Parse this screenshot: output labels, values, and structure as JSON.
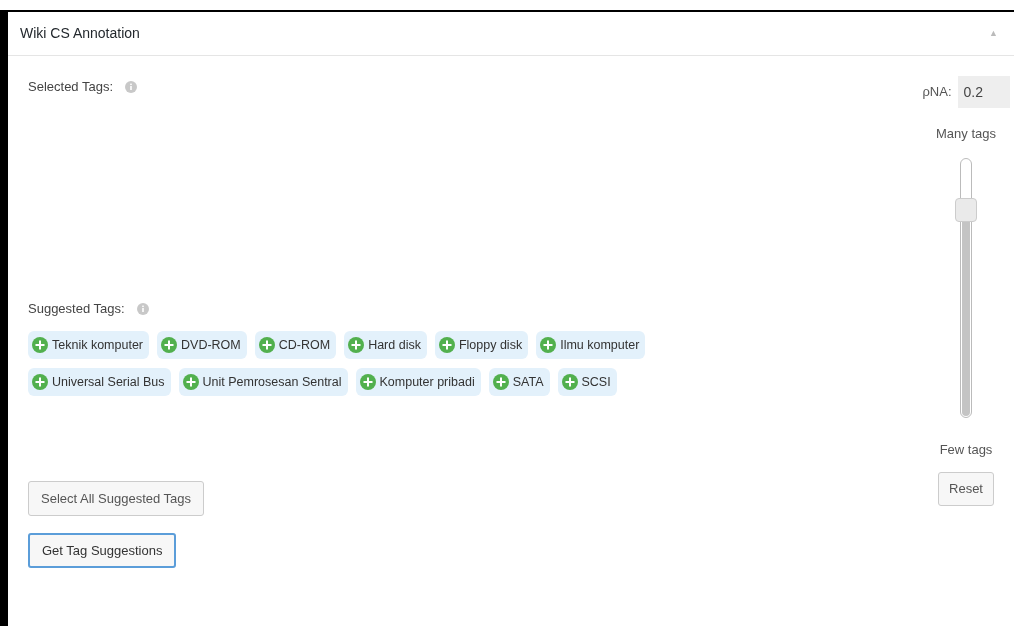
{
  "panel": {
    "title": "Wiki CS Annotation",
    "collapse_icon": "▲"
  },
  "selected_tags": {
    "label": "Selected Tags:"
  },
  "suggested_tags": {
    "label": "Suggested Tags:",
    "tags": [
      {
        "label": "Teknik komputer"
      },
      {
        "label": "DVD-ROM"
      },
      {
        "label": "CD-ROM"
      },
      {
        "label": "Hard disk"
      },
      {
        "label": "Floppy disk"
      },
      {
        "label": "Ilmu komputer"
      },
      {
        "label": "Universal Serial Bus"
      },
      {
        "label": "Unit Pemrosesan Sentral"
      },
      {
        "label": "Komputer pribadi"
      },
      {
        "label": "SATA"
      },
      {
        "label": "SCSI"
      }
    ]
  },
  "buttons": [
    {
      "label": "Select All Suggested Tags",
      "focused": false
    },
    {
      "label": "Get Tag Suggestions",
      "focused": true
    }
  ],
  "pna": {
    "label": "ρNA:",
    "value": "0.2",
    "top_label": "Many tags",
    "bottom_label": "Few tags",
    "slider": {
      "level": 0.8
    },
    "reset": "Reset"
  }
}
